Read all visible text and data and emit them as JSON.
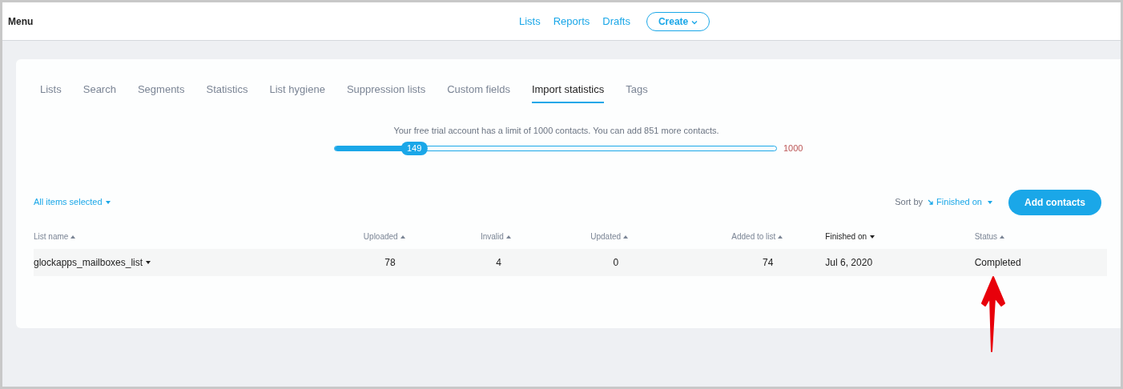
{
  "header": {
    "title": "Menu",
    "nav": [
      {
        "label": "Lists"
      },
      {
        "label": "Reports"
      },
      {
        "label": "Drafts"
      }
    ],
    "create_button": "Create"
  },
  "tabs": [
    {
      "label": "Lists",
      "selected": false
    },
    {
      "label": "Search",
      "selected": false
    },
    {
      "label": "Segments",
      "selected": false
    },
    {
      "label": "Statistics",
      "selected": false
    },
    {
      "label": "List hygiene",
      "selected": false
    },
    {
      "label": "Suppression lists",
      "selected": false
    },
    {
      "label": "Custom fields",
      "selected": false
    },
    {
      "label": "Import statistics",
      "selected": true
    },
    {
      "label": "Tags",
      "selected": false
    }
  ],
  "limit": {
    "message": "Your free trial account has a limit of 1000 contacts. You can add 851 more contacts.",
    "level": 0.18,
    "reading": "149",
    "max": "1000"
  },
  "toolbar": {
    "selection": "All items selected",
    "sort_label": "Sort by",
    "sort_value": "Finished on",
    "add_button": "Add contacts"
  },
  "table": {
    "columns": [
      {
        "label": "List name",
        "sorted": false
      },
      {
        "label": "Uploaded",
        "sorted": false
      },
      {
        "label": "Invalid",
        "sorted": false
      },
      {
        "label": "Updated",
        "sorted": false
      },
      {
        "label": "Added to list",
        "sorted": false
      },
      {
        "label": "Finished on",
        "sorted": true
      },
      {
        "label": "Status",
        "sorted": false
      }
    ],
    "rows": [
      [
        "glockapps_mailboxes_list",
        "78",
        "4",
        "0",
        "74",
        "Jul 6, 2020",
        "Completed"
      ]
    ]
  }
}
